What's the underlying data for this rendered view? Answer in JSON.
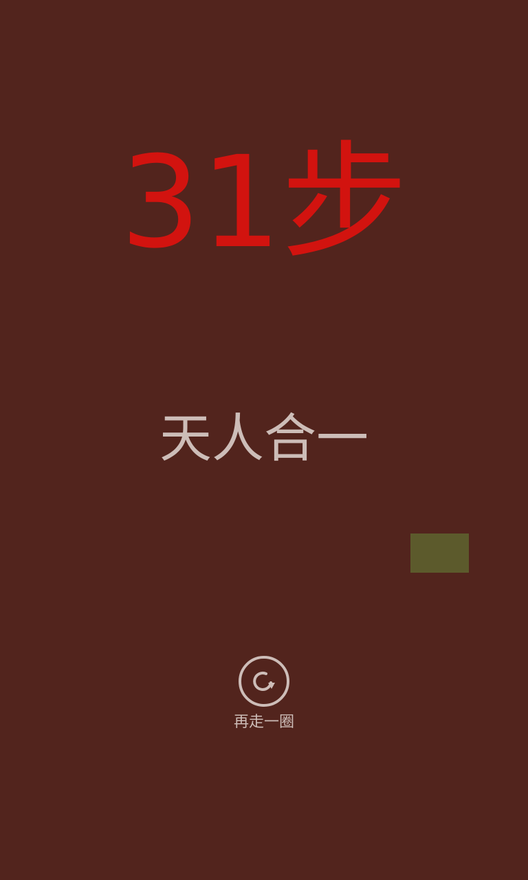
{
  "colors": {
    "background": "#52241d",
    "score_text": "#d2130f",
    "rank_text": "#cdbdb8",
    "tile": "#5c5a2c",
    "replay": "#cdbdb8"
  },
  "result": {
    "score": "31步",
    "rank_title": "天人合一"
  },
  "replay": {
    "icon": "replay-icon",
    "label": "再走一圈"
  }
}
